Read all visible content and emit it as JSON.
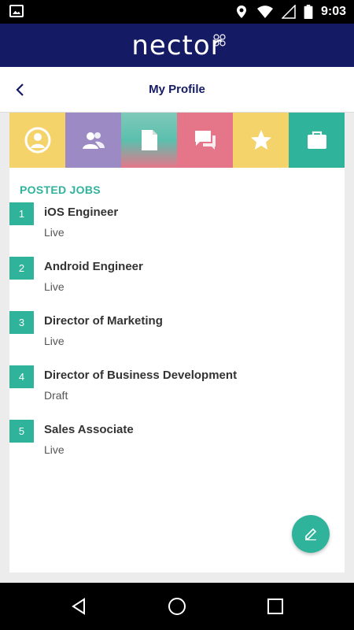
{
  "status_bar": {
    "time": "9:03",
    "icons": [
      "image-icon",
      "location-icon",
      "wifi-icon",
      "signal-icon",
      "battery-icon"
    ]
  },
  "app": {
    "logo": "nector",
    "header_color": "#141a63",
    "accent_color": "#2fb39b"
  },
  "title_bar": {
    "title": "My Profile",
    "back_icon": "chevron-left-icon"
  },
  "tabs": [
    {
      "name": "profile",
      "icon": "person-icon",
      "color": "#f5d36b"
    },
    {
      "name": "connections",
      "icon": "people-icon",
      "color": "#9b8ac3"
    },
    {
      "name": "documents",
      "icon": "document-icon",
      "color": "#5bbfae"
    },
    {
      "name": "messages",
      "icon": "chat-icon",
      "color": "#e5768a"
    },
    {
      "name": "favorites",
      "icon": "star-icon",
      "color": "#f5d36b"
    },
    {
      "name": "jobs",
      "icon": "briefcase-icon",
      "color": "#2fb39b"
    }
  ],
  "section": {
    "title": "POSTED JOBS"
  },
  "jobs": [
    {
      "number": "1",
      "title": "iOS Engineer",
      "status": "Live"
    },
    {
      "number": "2",
      "title": "Android Engineer",
      "status": "Live"
    },
    {
      "number": "3",
      "title": "Director of Marketing",
      "status": "Live"
    },
    {
      "number": "4",
      "title": "Director of Business Development",
      "status": "Draft"
    },
    {
      "number": "5",
      "title": "Sales Associate",
      "status": "Live"
    }
  ],
  "fab": {
    "icon": "pencil-icon"
  },
  "nav": {
    "icons": [
      "back-icon",
      "home-icon",
      "recents-icon"
    ]
  }
}
